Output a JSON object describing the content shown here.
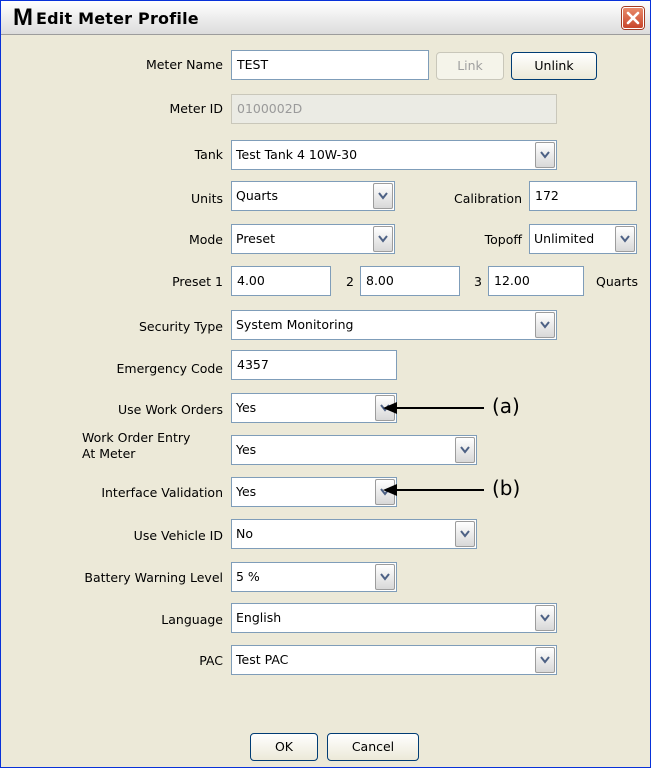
{
  "window": {
    "title": "Edit Meter Profile",
    "icon": "M",
    "close_icon": "close-icon"
  },
  "labels": {
    "meter_name": "Meter Name",
    "meter_id": "Meter ID",
    "tank": "Tank",
    "units": "Units",
    "calibration": "Calibration",
    "mode": "Mode",
    "topoff": "Topoff",
    "preset1": "Preset 1",
    "preset2": "2",
    "preset3": "3",
    "preset_units": "Quarts",
    "security_type": "Security Type",
    "emergency_code": "Emergency Code",
    "use_work_orders": "Use Work Orders",
    "work_order_entry_line1": "Work Order Entry",
    "work_order_entry_line2": "At Meter",
    "interface_validation": "Interface Validation",
    "use_vehicle_id": "Use Vehicle ID",
    "battery_warning": "Battery Warning Level",
    "language": "Language",
    "pac": "PAC"
  },
  "values": {
    "meter_name": "TEST",
    "meter_id": "0100002D",
    "tank": "Test Tank 4 10W-30",
    "units": "Quarts",
    "calibration": "172",
    "mode": "Preset",
    "topoff": "Unlimited",
    "preset1": "4.00",
    "preset2": "8.00",
    "preset3": "12.00",
    "security_type": "System Monitoring",
    "emergency_code": "4357",
    "use_work_orders": "Yes",
    "work_order_entry": "Yes",
    "interface_validation": "Yes",
    "use_vehicle_id": "No",
    "battery_warning": "5 %",
    "language": "English",
    "pac": "Test PAC"
  },
  "buttons": {
    "link": "Link",
    "unlink": "Unlink",
    "ok": "OK",
    "cancel": "Cancel"
  },
  "annotations": {
    "a": "(a)",
    "b": "(b)"
  }
}
